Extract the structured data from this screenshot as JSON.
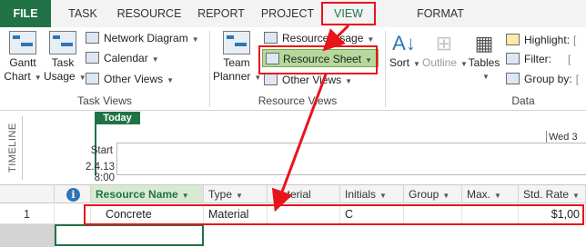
{
  "tabs": [
    "FILE",
    "TASK",
    "RESOURCE",
    "REPORT",
    "PROJECT",
    "VIEW",
    "FORMAT"
  ],
  "ribbon": {
    "task_views": {
      "group_label": "Task Views",
      "gantt_chart": "Gantt Chart",
      "gantt_line1": "Gantt",
      "gantt_line2": "Chart",
      "task_usage_line1": "Task",
      "task_usage_line2": "Usage",
      "network_diagram": "Network Diagram",
      "calendar": "Calendar",
      "other_views": "Other Views"
    },
    "resource_views": {
      "group_label": "Resource Views",
      "team_planner_line1": "Team",
      "team_planner_line2": "Planner",
      "resource_usage": "Resource Usage",
      "resource_sheet": "Resource Sheet",
      "other_views": "Other Views"
    },
    "data": {
      "group_label": "Data",
      "sort": "Sort",
      "outline": "Outline",
      "tables": "Tables",
      "highlight": "Highlight:",
      "filter": "Filter:",
      "group_by": "Group by:"
    }
  },
  "timeline": {
    "label": "TIMELINE",
    "today": "Today",
    "start_label": "Start",
    "start_date": "2.4.13 8:00",
    "right_date": "Wed 3"
  },
  "grid": {
    "info_icon": "i",
    "columns": [
      "Resource Name",
      "Type",
      "Material",
      "Initials",
      "Group",
      "Max.",
      "Std. Rate"
    ],
    "rows": [
      {
        "num": "1",
        "name": "Concrete",
        "type": "Material",
        "material": "",
        "initials": "C",
        "group": "",
        "max": "",
        "std_rate": "$1,00"
      }
    ]
  },
  "colors": {
    "accent": "#217346",
    "annotation": "#e8141c",
    "highlight": "#b5d99c"
  }
}
